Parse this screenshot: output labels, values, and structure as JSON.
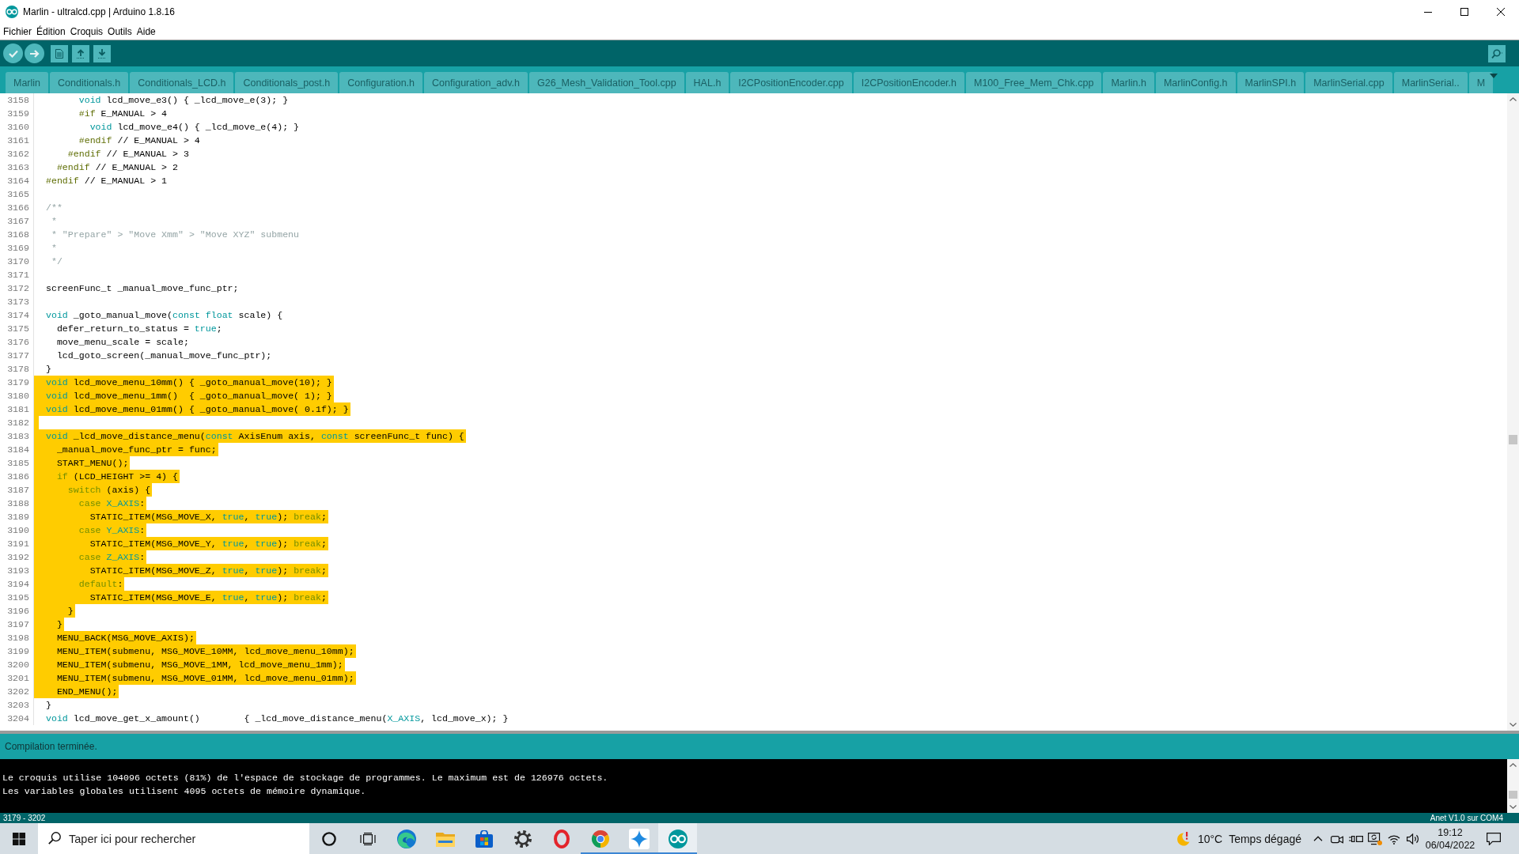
{
  "window": {
    "title": "Marlin - ultralcd.cpp | Arduino 1.8.16"
  },
  "menu_bar": [
    "Fichier",
    "Édition",
    "Croquis",
    "Outils",
    "Aide"
  ],
  "tabs": [
    {
      "label": "Marlin",
      "selected": false
    },
    {
      "label": "Conditionals.h",
      "selected": false
    },
    {
      "label": "Conditionals_LCD.h",
      "selected": false
    },
    {
      "label": "Conditionals_post.h",
      "selected": false
    },
    {
      "label": "Configuration.h",
      "selected": false
    },
    {
      "label": "Configuration_adv.h",
      "selected": false
    },
    {
      "label": "G26_Mesh_Validation_Tool.cpp",
      "selected": false
    },
    {
      "label": "HAL.h",
      "selected": false
    },
    {
      "label": "I2CPositionEncoder.cpp",
      "selected": false
    },
    {
      "label": "I2CPositionEncoder.h",
      "selected": false
    },
    {
      "label": "M100_Free_Mem_Chk.cpp",
      "selected": false
    },
    {
      "label": "Marlin.h",
      "selected": false
    },
    {
      "label": "MarlinConfig.h",
      "selected": false
    },
    {
      "label": "MarlinSPI.h",
      "selected": false
    },
    {
      "label": "MarlinSerial.cpp",
      "selected": false
    },
    {
      "label": "MarlinSerial..",
      "selected": false
    },
    {
      "label": "M",
      "selected": false
    }
  ],
  "editor": {
    "lines": [
      {
        "number": "3158",
        "selected": false,
        "tokens": [
          {
            "kind": "type",
            "text": "      void"
          },
          {
            "kind": "plain",
            "text": " lcd_move_e3() { _lcd_move_e(3); }"
          }
        ]
      },
      {
        "number": "3159",
        "selected": false,
        "tokens": [
          {
            "kind": "directive",
            "text": "      #if"
          },
          {
            "kind": "plain",
            "text": " E_MANUAL > 4"
          }
        ]
      },
      {
        "number": "3160",
        "selected": false,
        "tokens": [
          {
            "kind": "type",
            "text": "        void"
          },
          {
            "kind": "plain",
            "text": " lcd_move_e4() { _lcd_move_e(4); }"
          }
        ]
      },
      {
        "number": "3161",
        "selected": false,
        "tokens": [
          {
            "kind": "directive",
            "text": "      #endif"
          },
          {
            "kind": "plain",
            "text": " // E_MANUAL > 4"
          }
        ]
      },
      {
        "number": "3162",
        "selected": false,
        "tokens": [
          {
            "kind": "directive",
            "text": "    #endif"
          },
          {
            "kind": "plain",
            "text": " // E_MANUAL > 3"
          }
        ]
      },
      {
        "number": "3163",
        "selected": false,
        "tokens": [
          {
            "kind": "directive",
            "text": "  #endif"
          },
          {
            "kind": "plain",
            "text": " // E_MANUAL > 2"
          }
        ]
      },
      {
        "number": "3164",
        "selected": false,
        "tokens": [
          {
            "kind": "directive",
            "text": "#endif"
          },
          {
            "kind": "plain",
            "text": " // E_MANUAL > 1"
          }
        ]
      },
      {
        "number": "3165",
        "selected": false
      },
      {
        "number": "3166",
        "selected": false,
        "tokens": [
          {
            "kind": "comment",
            "text": "/**"
          }
        ]
      },
      {
        "number": "3167",
        "selected": false,
        "tokens": [
          {
            "kind": "comment",
            "text": " *"
          }
        ]
      },
      {
        "number": "3168",
        "selected": false,
        "tokens": [
          {
            "kind": "comment",
            "text": " * \"Prepare\" > \"Move Xmm\" > \"Move XYZ\" submenu"
          }
        ]
      },
      {
        "number": "3169",
        "selected": false,
        "tokens": [
          {
            "kind": "comment",
            "text": " *"
          }
        ]
      },
      {
        "number": "3170",
        "selected": false,
        "tokens": [
          {
            "kind": "comment",
            "text": " */"
          }
        ]
      },
      {
        "number": "3171",
        "selected": false
      },
      {
        "number": "3172",
        "selected": false,
        "tokens": [
          {
            "kind": "plain",
            "text": "screenFunc_t _manual_move_func_ptr;"
          }
        ]
      },
      {
        "number": "3173",
        "selected": false
      },
      {
        "number": "3174",
        "selected": false,
        "tokens": [
          {
            "kind": "type",
            "text": "void"
          },
          {
            "kind": "plain",
            "text": " _goto_manual_move("
          },
          {
            "kind": "type",
            "text": "const float"
          },
          {
            "kind": "plain",
            "text": " scale) {"
          }
        ]
      },
      {
        "number": "3175",
        "selected": false,
        "tokens": [
          {
            "kind": "plain",
            "text": "  defer_return_to_status = "
          },
          {
            "kind": "literal",
            "text": "true"
          },
          {
            "kind": "plain",
            "text": ";"
          }
        ]
      },
      {
        "number": "3176",
        "selected": false,
        "tokens": [
          {
            "kind": "plain",
            "text": "  move_menu_scale = scale;"
          }
        ]
      },
      {
        "number": "3177",
        "selected": false,
        "tokens": [
          {
            "kind": "plain",
            "text": "  lcd_goto_screen(_manual_move_func_ptr);"
          }
        ]
      },
      {
        "number": "3178",
        "selected": false,
        "tokens": [
          {
            "kind": "plain",
            "text": "}"
          }
        ]
      },
      {
        "number": "3179",
        "selected": true,
        "tokens": [
          {
            "kind": "type",
            "text": "void"
          },
          {
            "kind": "plain",
            "text": " lcd_move_menu_10mm() { _goto_manual_move(10); }"
          }
        ]
      },
      {
        "number": "3180",
        "selected": true,
        "tokens": [
          {
            "kind": "type",
            "text": "void"
          },
          {
            "kind": "plain",
            "text": " lcd_move_menu_1mm()  { _goto_manual_move( 1); }"
          }
        ]
      },
      {
        "number": "3181",
        "selected": true,
        "tokens": [
          {
            "kind": "type",
            "text": "void"
          },
          {
            "kind": "plain",
            "text": " lcd_move_menu_01mm() { _goto_manual_move( 0.1f); }"
          }
        ]
      },
      {
        "number": "3182",
        "selected": true
      },
      {
        "number": "3183",
        "selected": true,
        "tokens": [
          {
            "kind": "type",
            "text": "void"
          },
          {
            "kind": "plain",
            "text": " _lcd_move_distance_menu("
          },
          {
            "kind": "type",
            "text": "const"
          },
          {
            "kind": "plain",
            "text": " AxisEnum axis, "
          },
          {
            "kind": "type",
            "text": "const"
          },
          {
            "kind": "plain",
            "text": " screenFunc_t func) {"
          }
        ]
      },
      {
        "number": "3184",
        "selected": true,
        "tokens": [
          {
            "kind": "plain",
            "text": "  _manual_move_func_ptr = func;"
          }
        ]
      },
      {
        "number": "3185",
        "selected": true,
        "tokens": [
          {
            "kind": "plain",
            "text": "  START_MENU();"
          }
        ]
      },
      {
        "number": "3186",
        "selected": true,
        "tokens": [
          {
            "kind": "control",
            "text": "  if"
          },
          {
            "kind": "plain",
            "text": " (LCD_HEIGHT >= 4) {"
          }
        ]
      },
      {
        "number": "3187",
        "selected": true,
        "tokens": [
          {
            "kind": "control",
            "text": "    switch"
          },
          {
            "kind": "plain",
            "text": " (axis) {"
          }
        ]
      },
      {
        "number": "3188",
        "selected": true,
        "tokens": [
          {
            "kind": "control",
            "text": "      case "
          },
          {
            "kind": "literal",
            "text": "X_AXIS"
          },
          {
            "kind": "plain",
            "text": ":"
          }
        ]
      },
      {
        "number": "3189",
        "selected": true,
        "tokens": [
          {
            "kind": "plain",
            "text": "        STATIC_ITEM(MSG_MOVE_X, "
          },
          {
            "kind": "literal",
            "text": "true"
          },
          {
            "kind": "plain",
            "text": ", "
          },
          {
            "kind": "literal",
            "text": "true"
          },
          {
            "kind": "plain",
            "text": "); "
          },
          {
            "kind": "control",
            "text": "break"
          },
          {
            "kind": "plain",
            "text": ";"
          }
        ]
      },
      {
        "number": "3190",
        "selected": true,
        "tokens": [
          {
            "kind": "control",
            "text": "      case "
          },
          {
            "kind": "literal",
            "text": "Y_AXIS"
          },
          {
            "kind": "plain",
            "text": ":"
          }
        ]
      },
      {
        "number": "3191",
        "selected": true,
        "tokens": [
          {
            "kind": "plain",
            "text": "        STATIC_ITEM(MSG_MOVE_Y, "
          },
          {
            "kind": "literal",
            "text": "true"
          },
          {
            "kind": "plain",
            "text": ", "
          },
          {
            "kind": "literal",
            "text": "true"
          },
          {
            "kind": "plain",
            "text": "); "
          },
          {
            "kind": "control",
            "text": "break"
          },
          {
            "kind": "plain",
            "text": ";"
          }
        ]
      },
      {
        "number": "3192",
        "selected": true,
        "tokens": [
          {
            "kind": "control",
            "text": "      case "
          },
          {
            "kind": "literal",
            "text": "Z_AXIS"
          },
          {
            "kind": "plain",
            "text": ":"
          }
        ]
      },
      {
        "number": "3193",
        "selected": true,
        "tokens": [
          {
            "kind": "plain",
            "text": "        STATIC_ITEM(MSG_MOVE_Z, "
          },
          {
            "kind": "literal",
            "text": "true"
          },
          {
            "kind": "plain",
            "text": ", "
          },
          {
            "kind": "literal",
            "text": "true"
          },
          {
            "kind": "plain",
            "text": "); "
          },
          {
            "kind": "control",
            "text": "break"
          },
          {
            "kind": "plain",
            "text": ";"
          }
        ]
      },
      {
        "number": "3194",
        "selected": true,
        "tokens": [
          {
            "kind": "control",
            "text": "      default"
          },
          {
            "kind": "plain",
            "text": ":"
          }
        ]
      },
      {
        "number": "3195",
        "selected": true,
        "tokens": [
          {
            "kind": "plain",
            "text": "        STATIC_ITEM(MSG_MOVE_E, "
          },
          {
            "kind": "literal",
            "text": "true"
          },
          {
            "kind": "plain",
            "text": ", "
          },
          {
            "kind": "literal",
            "text": "true"
          },
          {
            "kind": "plain",
            "text": "); "
          },
          {
            "kind": "control",
            "text": "break"
          },
          {
            "kind": "plain",
            "text": ";"
          }
        ]
      },
      {
        "number": "3196",
        "selected": true,
        "tokens": [
          {
            "kind": "plain",
            "text": "    }"
          }
        ]
      },
      {
        "number": "3197",
        "selected": true,
        "tokens": [
          {
            "kind": "plain",
            "text": "  }"
          }
        ]
      },
      {
        "number": "3198",
        "selected": true,
        "tokens": [
          {
            "kind": "plain",
            "text": "  MENU_BACK(MSG_MOVE_AXIS);"
          }
        ]
      },
      {
        "number": "3199",
        "selected": true,
        "tokens": [
          {
            "kind": "plain",
            "text": "  MENU_ITEM(submenu, MSG_MOVE_10MM, lcd_move_menu_10mm);"
          }
        ]
      },
      {
        "number": "3200",
        "selected": true,
        "tokens": [
          {
            "kind": "plain",
            "text": "  MENU_ITEM(submenu, MSG_MOVE_1MM, lcd_move_menu_1mm);"
          }
        ]
      },
      {
        "number": "3201",
        "selected": true,
        "tokens": [
          {
            "kind": "plain",
            "text": "  MENU_ITEM(submenu, MSG_MOVE_01MM, lcd_move_menu_01mm);"
          }
        ]
      },
      {
        "number": "3202",
        "selected": true,
        "tokens": [
          {
            "kind": "plain",
            "text": "  END_MENU();"
          }
        ]
      },
      {
        "number": "3203",
        "selected": false,
        "tokens": [
          {
            "kind": "plain",
            "text": "}"
          }
        ]
      },
      {
        "number": "3204",
        "selected": false,
        "tokens": [
          {
            "kind": "type",
            "text": "void"
          },
          {
            "kind": "plain",
            "text": " lcd_move_get_x_amount()        { _lcd_move_distance_menu("
          },
          {
            "kind": "literal",
            "text": "X_AXIS"
          },
          {
            "kind": "plain",
            "text": ", lcd_move_x); }"
          }
        ]
      }
    ]
  },
  "message": "Compilation terminée.",
  "console": [
    "Le croquis utilise 104096 octets (81%) de l'espace de stockage de programmes. Le maximum est de 126976 octets.",
    "Les variables globales utilisent 4095 octets de mémoire dynamique."
  ],
  "status_bar": {
    "line_range": "3179 - 3202",
    "board": "Anet V1.0 sur COM4"
  },
  "taskbar": {
    "search": {
      "placeholder": "Taper ici pour rechercher"
    },
    "apps": [
      {
        "kind": "circle",
        "running": false,
        "selected": false
      },
      {
        "kind": "task-view",
        "running": false,
        "selected": false
      },
      {
        "kind": "swirl",
        "running": false,
        "selected": false
      },
      {
        "kind": "folder",
        "running": false,
        "selected": false
      },
      {
        "kind": "bag",
        "running": false,
        "selected": false
      },
      {
        "kind": "gear",
        "running": false,
        "selected": false
      },
      {
        "kind": "oval",
        "running": false,
        "selected": false
      },
      {
        "kind": "tricolor",
        "running": true,
        "selected": false
      },
      {
        "kind": "star",
        "running": true,
        "selected": false
      },
      {
        "kind": "infinity",
        "running": true,
        "selected": true
      }
    ],
    "weather": {
      "temperature": "10°C",
      "condition": "Temps dégagé"
    },
    "clock": {
      "time": "19:12",
      "date": "06/04/2022"
    }
  }
}
